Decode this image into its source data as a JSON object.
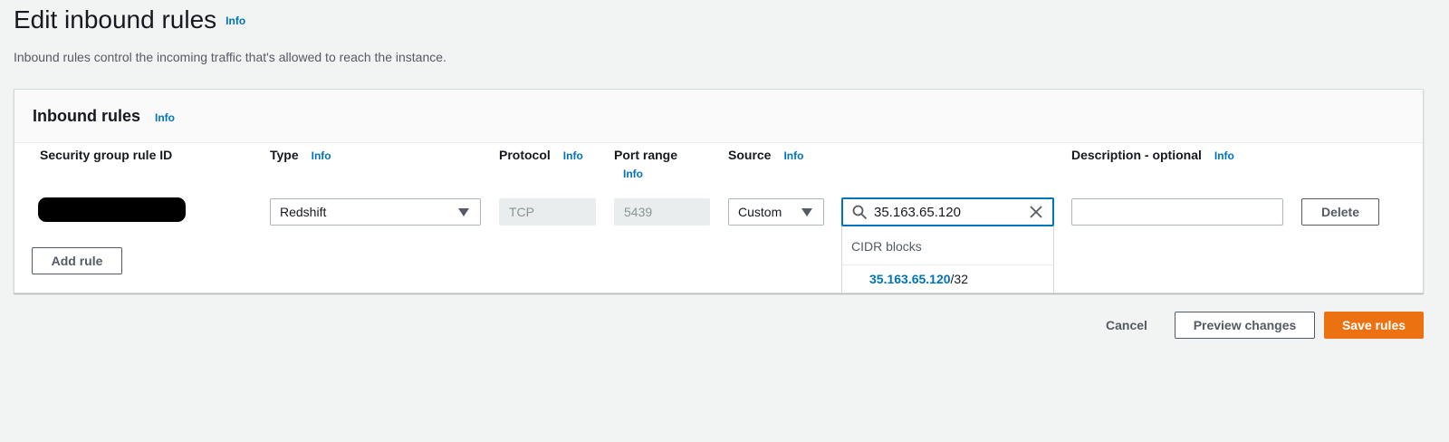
{
  "page": {
    "title": "Edit inbound rules",
    "title_info": "Info",
    "description": "Inbound rules control the incoming traffic that's allowed to reach the instance."
  },
  "panel": {
    "title": "Inbound rules",
    "title_info": "Info",
    "columns": {
      "rule_id": "Security group rule ID",
      "type": "Type",
      "type_info": "Info",
      "protocol": "Protocol",
      "protocol_info": "Info",
      "port_range": "Port range",
      "port_range_info": "Info",
      "source": "Source",
      "source_info": "Info",
      "description": "Description - optional",
      "description_info": "Info"
    },
    "row": {
      "type": "Redshift",
      "protocol": "TCP",
      "port_range": "5439",
      "source_type": "Custom",
      "source_value": "35.163.65.120",
      "description_value": "",
      "delete_label": "Delete"
    },
    "dropdown": {
      "group_label": "CIDR blocks",
      "option_match": "35.163.65.120",
      "option_suffix": "/32"
    },
    "add_rule_label": "Add rule"
  },
  "footer": {
    "cancel_label": "Cancel",
    "preview_label": "Preview changes",
    "save_label": "Save rules"
  },
  "colors": {
    "primary": "#ec7211",
    "link": "#0073bb",
    "background": "#f2f3f3"
  }
}
